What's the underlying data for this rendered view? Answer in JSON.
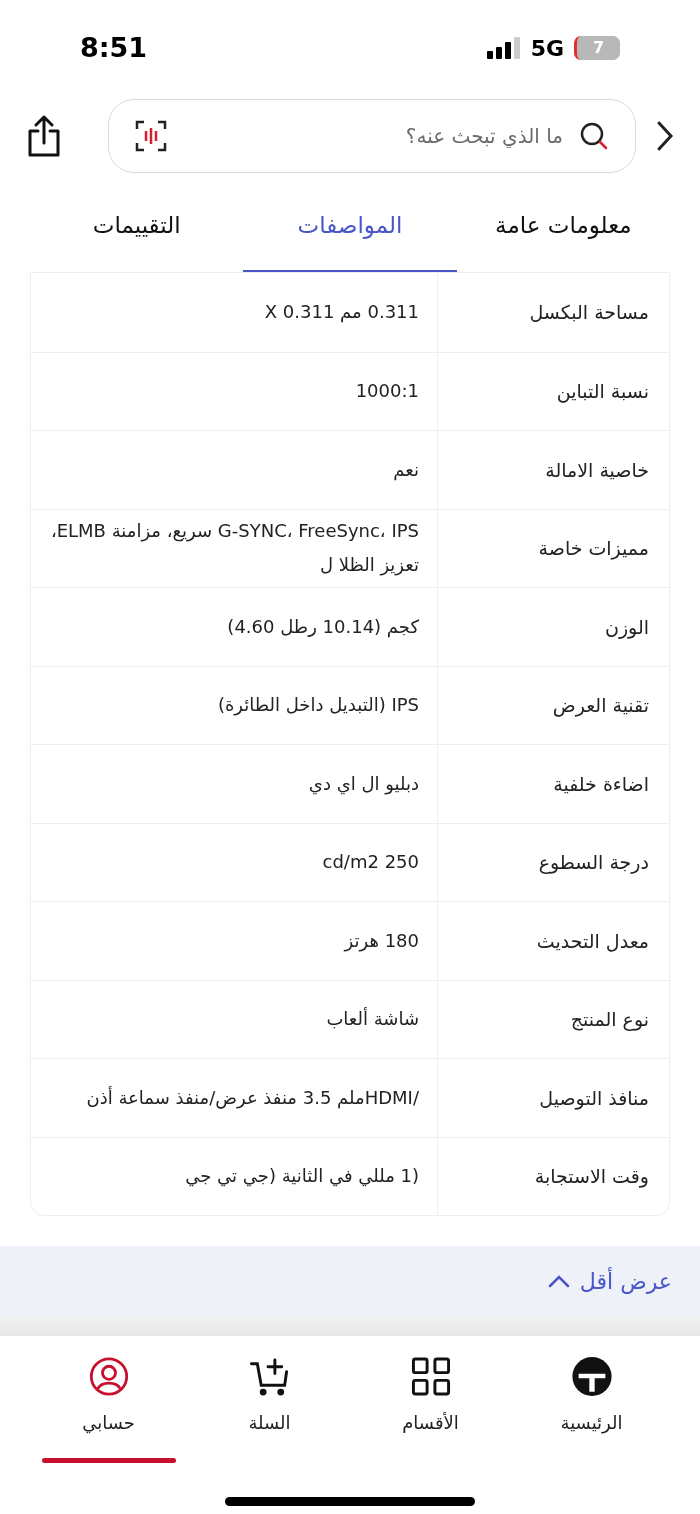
{
  "status_bar": {
    "time": "8:51",
    "network": "5G",
    "battery": "7"
  },
  "search": {
    "placeholder": "ما الذي تبحث عنه؟"
  },
  "tabs": [
    {
      "label": "معلومات عامة",
      "selected": false
    },
    {
      "label": "المواصفات",
      "selected": true
    },
    {
      "label": "التقييمات",
      "selected": false
    }
  ],
  "specs": [
    {
      "label": "مساحة البكسل",
      "value": "0.311 مم X 0.311"
    },
    {
      "label": "نسبة التباين",
      "value": "1000:1"
    },
    {
      "label": "خاصية الامالة",
      "value": "نعم"
    },
    {
      "label": "مميزات خاصة",
      "value": "G-SYNC، FreeSync، IPS سريع، مزامنة ELMB، تعزيز الظلا ل"
    },
    {
      "label": "الوزن",
      "value": "كجم (10.14 رطل 4.60)"
    },
    {
      "label": "تقنية العرض",
      "value": "IPS (التبديل داخل الطائرة)"
    },
    {
      "label": "اضاءة خلفية",
      "value": "دبليو ال اي دي"
    },
    {
      "label": "درجة السطوع",
      "value": "cd/m2 250"
    },
    {
      "label": "معدل التحديث",
      "value": "180 هرتز"
    },
    {
      "label": "نوع المنتج",
      "value": "شاشة ألعاب"
    },
    {
      "label": "منافذ التوصيل",
      "value": "/HDMIملم 3.5 منفذ عرض/منفذ سماعة أذن"
    },
    {
      "label": "وقت الاستجابة",
      "value": "(1 مللي في الثانية (جي تي جي"
    }
  ],
  "show_less": "عرض أقل",
  "nav": [
    {
      "kind": "home",
      "label": "الرئيسية",
      "selected": false
    },
    {
      "kind": "categories",
      "label": "الأقسام",
      "selected": false
    },
    {
      "kind": "cart",
      "label": "السلة",
      "selected": false
    },
    {
      "kind": "account",
      "label": "حسابي",
      "selected": true
    }
  ]
}
